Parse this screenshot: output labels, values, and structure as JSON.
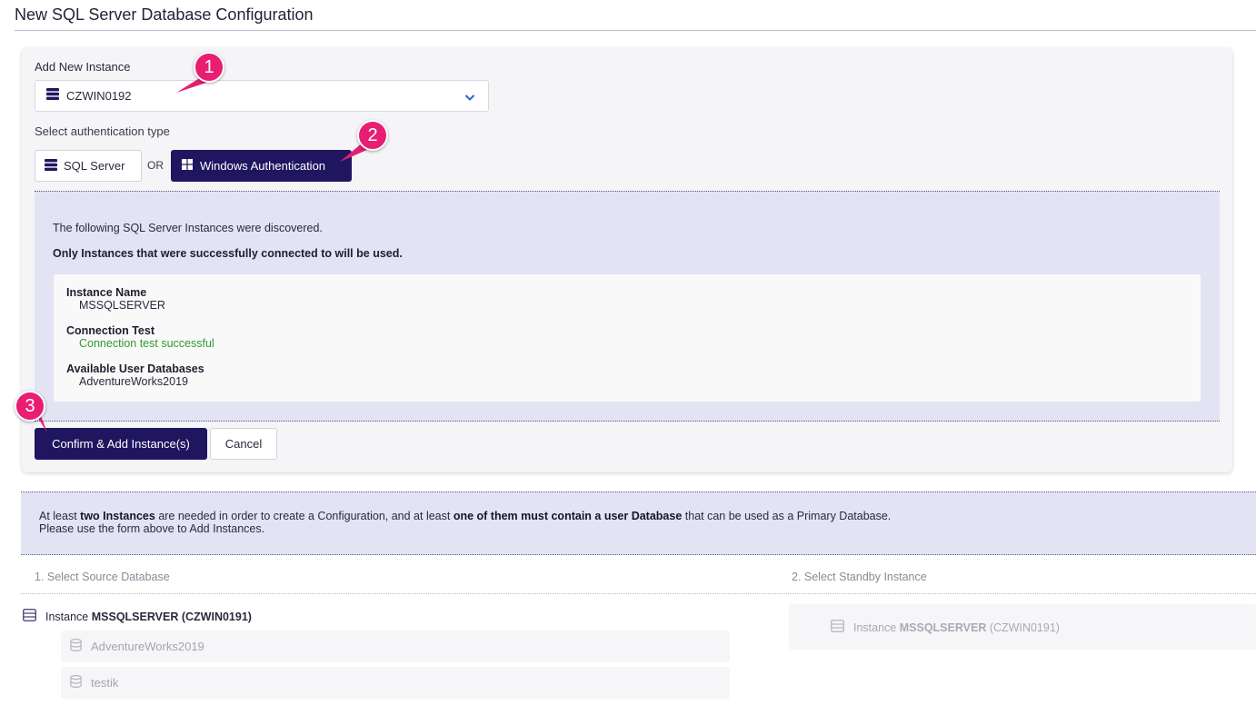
{
  "page": {
    "title": "New SQL Server Database Configuration"
  },
  "add_instance": {
    "label": "Add New Instance",
    "selected_value": "CZWIN0192",
    "icon": "server-icon",
    "chevron_icon": "chevron-down-icon"
  },
  "auth": {
    "label": "Select authentication type",
    "sql_server_label": "SQL Server",
    "or_label": "OR",
    "windows_label": "Windows Authentication",
    "selected": "Windows Authentication"
  },
  "discovery": {
    "intro": "The following SQL Server Instances were discovered.",
    "note": "Only Instances that were successfully connected to will be used.",
    "instance": {
      "name_label": "Instance Name",
      "name_value": "MSSQLSERVER",
      "conn_label": "Connection Test",
      "conn_value": "Connection test successful",
      "dbs_label": "Available User Databases",
      "dbs_value": "AdventureWorks2019"
    }
  },
  "actions": {
    "confirm_label": "Confirm & Add Instance(s)",
    "cancel_label": "Cancel"
  },
  "annotations": {
    "badge1": "1",
    "badge2": "2",
    "badge3": "3",
    "color": "#e81e72"
  },
  "notice": {
    "p1": "At least ",
    "b1": "two Instances",
    "p2": " are needed in order to create a Configuration, and at least ",
    "b2": "one of them must contain a user Database",
    "p3": " that can be used as a Primary Database.",
    "line2": "Please use the form above to Add Instances."
  },
  "steps": {
    "source_label": "1. Select Source Database",
    "standby_label": "2. Select Standby Instance",
    "source_instance_prefix": "Instance ",
    "source_instance_name": "MSSQLSERVER",
    "source_instance_host": "(CZWIN0191)",
    "databases": [
      "AdventureWorks2019",
      "testik"
    ],
    "standby_instance_prefix": "Instance ",
    "standby_instance_name": "MSSQLSERVER",
    "standby_instance_host": "(CZWIN0191)"
  },
  "colors": {
    "primary": "#201660",
    "success": "#2f9a2f",
    "panel": "#e2e3f3"
  }
}
